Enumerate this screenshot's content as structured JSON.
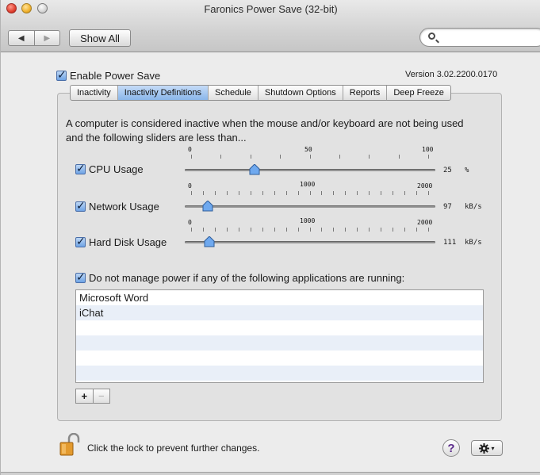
{
  "window": {
    "title": "Faronics Power Save (32-bit)"
  },
  "toolbar": {
    "back_glyph": "◀",
    "forward_glyph": "▶",
    "show_all_label": "Show All",
    "search_placeholder": ""
  },
  "header": {
    "enable_label": "Enable Power Save",
    "enable_checked": true,
    "version": "Version 3.02.2200.0170"
  },
  "tabs": [
    {
      "label": "Inactivity",
      "active": false
    },
    {
      "label": "Inactivity Definitions",
      "active": true
    },
    {
      "label": "Schedule",
      "active": false
    },
    {
      "label": "Shutdown Options",
      "active": false
    },
    {
      "label": "Reports",
      "active": false
    },
    {
      "label": "Deep Freeze",
      "active": false
    }
  ],
  "description": "A computer is considered inactive when the mouse and/or keyboard are not being used and the following sliders are less than...",
  "sliders": [
    {
      "label": "CPU Usage",
      "checked": true,
      "min": 0,
      "mid": 50,
      "max": 100,
      "min_label": "0",
      "mid_label": "50",
      "max_label": "100",
      "value": 25,
      "value_label": "25",
      "unit": "%"
    },
    {
      "label": "Network Usage",
      "checked": true,
      "min": 0,
      "mid": 1000,
      "max": 2000,
      "min_label": "0",
      "mid_label": "1000",
      "max_label": "2000",
      "value": 97,
      "value_label": "97",
      "unit": "kB/s"
    },
    {
      "label": "Hard Disk Usage",
      "checked": true,
      "min": 0,
      "mid": 1000,
      "max": 2000,
      "min_label": "0",
      "mid_label": "1000",
      "max_label": "2000",
      "value": 111,
      "value_label": "111",
      "unit": "kB/s"
    }
  ],
  "apps_section": {
    "label": "Do not manage power if any of the following applications are running:",
    "checked": true,
    "items": [
      "Microsoft Word",
      "iChat",
      "",
      "",
      "",
      ""
    ],
    "add_label": "+",
    "remove_label": "−"
  },
  "footer": {
    "lock_text": "Click the lock to prevent further changes.",
    "help_label": "?",
    "gear_caret": "▾"
  },
  "colors": {
    "active_tab": "#8ab6ea",
    "checkbox": "#6ea3e5",
    "slider_thumb": "#6fa9ef"
  }
}
